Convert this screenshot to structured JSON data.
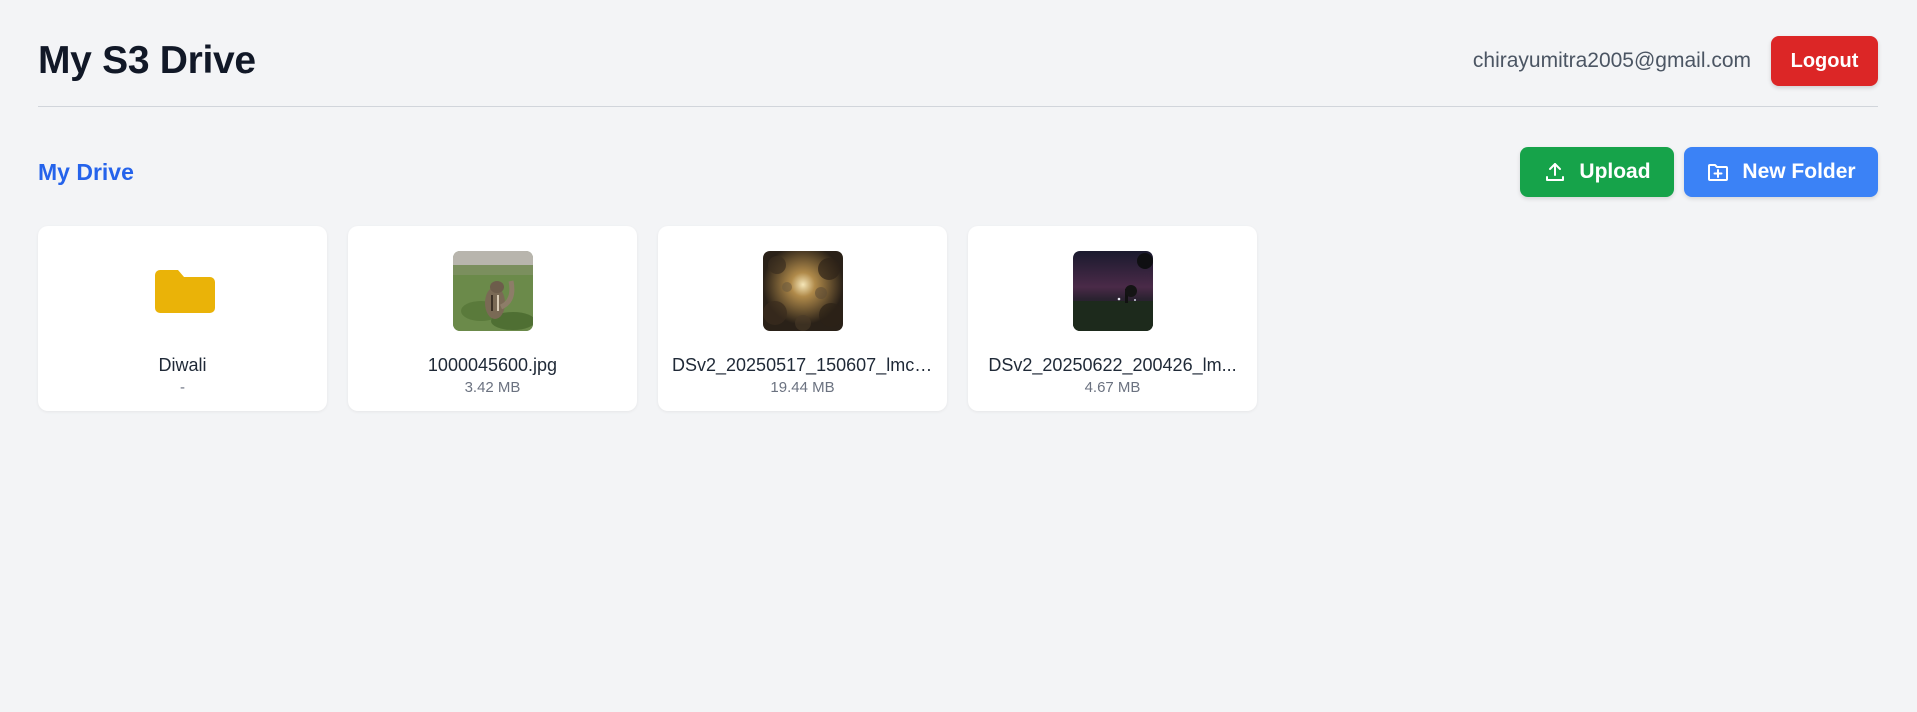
{
  "header": {
    "title": "My S3 Drive",
    "user_email": "chirayumitra2005@gmail.com",
    "logout_label": "Logout"
  },
  "toolbar": {
    "breadcrumb": "My Drive",
    "upload_label": "Upload",
    "new_folder_label": "New Folder"
  },
  "items": [
    {
      "name": "Diwali",
      "size": "-",
      "kind": "folder",
      "icon": "folder-icon"
    },
    {
      "name": "1000045600.jpg",
      "size": "3.42 MB",
      "kind": "image",
      "icon": "image-thumbnail"
    },
    {
      "name": "DSv2_20250517_150607_lmc_...",
      "size": "19.44 MB",
      "kind": "image",
      "icon": "image-thumbnail"
    },
    {
      "name": "DSv2_20250622_200426_lm...",
      "size": "4.67 MB",
      "kind": "image",
      "icon": "image-thumbnail"
    }
  ],
  "colors": {
    "background": "#f3f4f6",
    "logout": "#dc2626",
    "upload": "#16a34a",
    "new_folder": "#3b82f6",
    "breadcrumb": "#2563eb",
    "folder": "#eab308"
  }
}
